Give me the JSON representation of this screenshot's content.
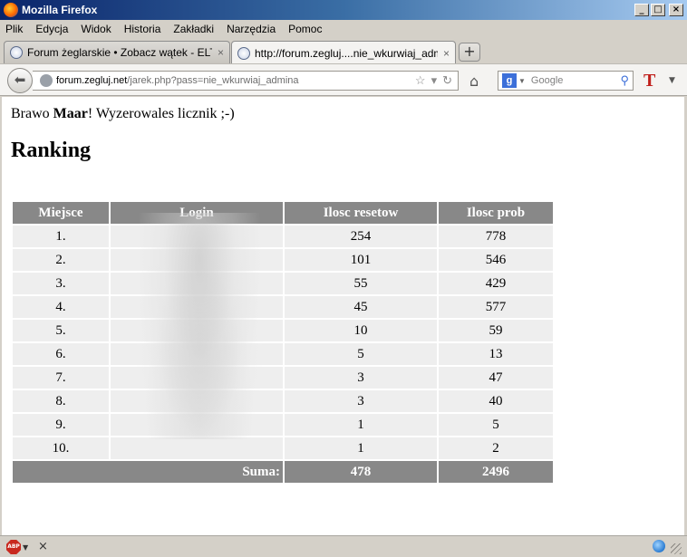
{
  "window": {
    "title": "Mozilla Firefox"
  },
  "menu": [
    "Plik",
    "Edycja",
    "Widok",
    "Historia",
    "Zakładki",
    "Narzędzia",
    "Pomoc"
  ],
  "tabs": [
    {
      "label": "Forum żeglarskie • Zobacz wątek - ELTAN...",
      "active": false
    },
    {
      "label": "http://forum.zegluj....nie_wkurwiaj_admina",
      "active": true
    }
  ],
  "navbar": {
    "url_host": "forum.zegluj.net",
    "url_path": "/jarek.php?pass=nie_wkurwiaj_admina",
    "search_placeholder": "Google"
  },
  "page": {
    "message_prefix": "Brawo ",
    "message_name": "Maar",
    "message_suffix": "! Wyzerowales licznik ;-)",
    "heading": "Ranking",
    "table": {
      "headers": [
        "Miejsce",
        "Login",
        "Ilosc resetow",
        "Ilosc prob"
      ],
      "rows": [
        {
          "place": "1.",
          "login": "",
          "resets": "254",
          "attempts": "778"
        },
        {
          "place": "2.",
          "login": "",
          "resets": "101",
          "attempts": "546"
        },
        {
          "place": "3.",
          "login": "",
          "resets": "55",
          "attempts": "429"
        },
        {
          "place": "4.",
          "login": "",
          "resets": "45",
          "attempts": "577"
        },
        {
          "place": "5.",
          "login": "",
          "resets": "10",
          "attempts": "59"
        },
        {
          "place": "6.",
          "login": "",
          "resets": "5",
          "attempts": "13"
        },
        {
          "place": "7.",
          "login": "",
          "resets": "3",
          "attempts": "47"
        },
        {
          "place": "8.",
          "login": "",
          "resets": "3",
          "attempts": "40"
        },
        {
          "place": "9.",
          "login": "",
          "resets": "1",
          "attempts": "5"
        },
        {
          "place": "10.",
          "login": "",
          "resets": "1",
          "attempts": "2"
        }
      ],
      "sum_label": "Suma:",
      "sum_resets": "478",
      "sum_attempts": "2496"
    }
  },
  "icons": {
    "back": "back-arrow-icon",
    "home": "home-icon",
    "search": "magnifier-icon",
    "addon": "adblock-plus-icon"
  }
}
